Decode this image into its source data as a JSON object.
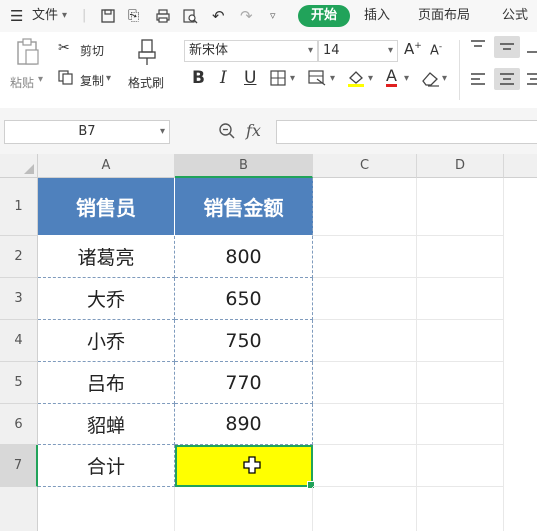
{
  "menubar": {
    "file_label": "文件",
    "tabs": [
      "开始",
      "插入",
      "页面布局",
      "公式"
    ]
  },
  "ribbon": {
    "paste_label": "粘贴",
    "cut_label": "剪切",
    "copy_label": "复制",
    "format_painter_label": "格式刷",
    "font_name": "新宋体",
    "font_size": "14"
  },
  "formula_bar": {
    "cell_ref": "B7",
    "fx_label": "fx",
    "formula": ""
  },
  "sheet": {
    "columns": [
      "A",
      "B",
      "C",
      "D"
    ],
    "rows": [
      "1",
      "2",
      "3",
      "4",
      "5",
      "6",
      "7"
    ],
    "headers": [
      "销售员",
      "销售金额"
    ],
    "data": [
      {
        "name": "诸葛亮",
        "amount": "800"
      },
      {
        "name": "大乔",
        "amount": "650"
      },
      {
        "name": "小乔",
        "amount": "750"
      },
      {
        "name": "吕布",
        "amount": "770"
      },
      {
        "name": "貂蝉",
        "amount": "890"
      }
    ],
    "total_label": "合计",
    "total_value": ""
  },
  "colors": {
    "accent_green": "#21a35a",
    "header_fill": "#4f81bd",
    "selected_fill": "#ffff00",
    "selection_border": "#21a35a"
  }
}
